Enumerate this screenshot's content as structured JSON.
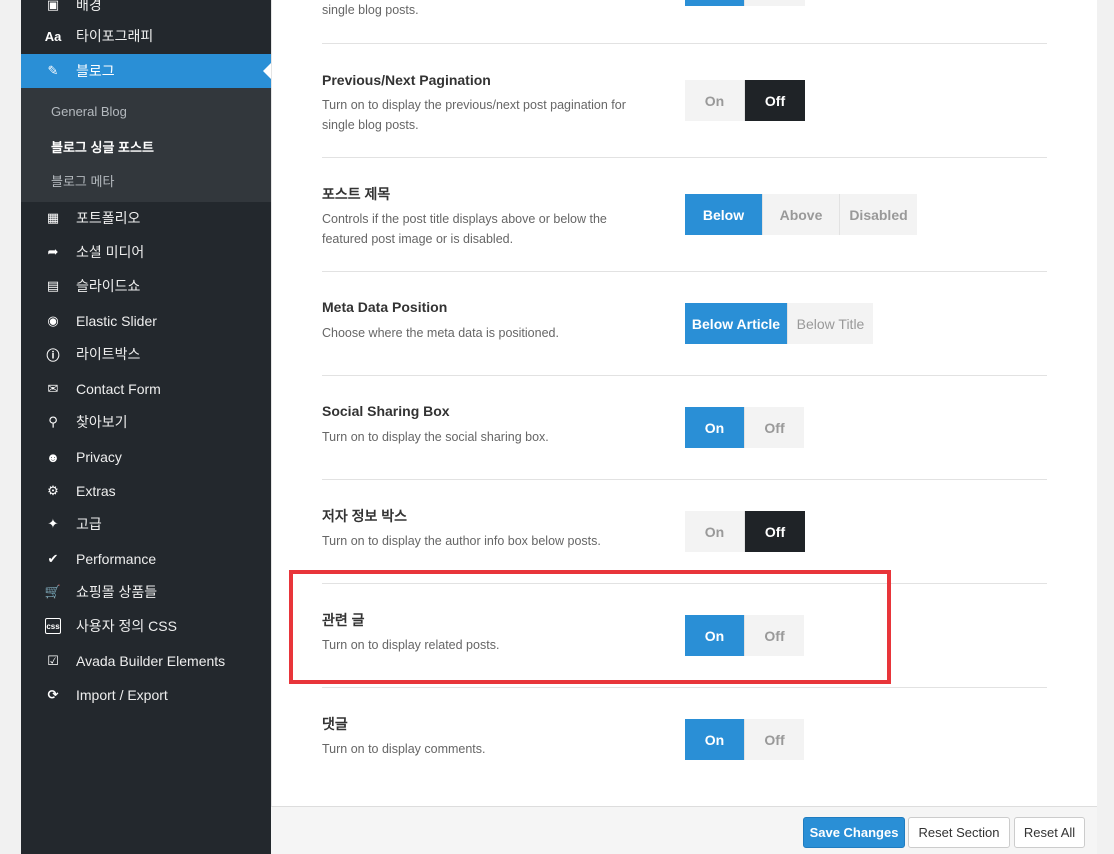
{
  "sidebar": {
    "items": [
      {
        "label": "배경",
        "icon": "layout-icon"
      },
      {
        "label": "타이포그래피",
        "icon": "typography-icon"
      },
      {
        "label": "블로그",
        "icon": "edit-icon"
      },
      {
        "label": "포트폴리오",
        "icon": "grid-icon"
      },
      {
        "label": "소셜 미디어",
        "icon": "share-icon"
      },
      {
        "label": "슬라이드쇼",
        "icon": "image-icon"
      },
      {
        "label": "Elastic Slider",
        "icon": "slider-icon"
      },
      {
        "label": "라이트박스",
        "icon": "info-icon"
      },
      {
        "label": "Contact Form",
        "icon": "envelope-icon"
      },
      {
        "label": "찾아보기",
        "icon": "search-icon"
      },
      {
        "label": "Privacy",
        "icon": "user-icon"
      },
      {
        "label": "Extras",
        "icon": "cogs-icon"
      },
      {
        "label": "고급",
        "icon": "puzzle-icon"
      },
      {
        "label": "Performance",
        "icon": "check-circle-icon"
      },
      {
        "label": "쇼핑몰 상품들",
        "icon": "cart-icon"
      },
      {
        "label": "사용자 정의 CSS",
        "icon": "css-icon"
      },
      {
        "label": "Avada Builder Elements",
        "icon": "checkbox-icon"
      },
      {
        "label": "Import / Export",
        "icon": "refresh-icon"
      }
    ],
    "submenu": [
      "General Blog",
      "블로그 싱글 포스트",
      "블로그 메타"
    ]
  },
  "settings": {
    "top_fragment": "single blog posts.",
    "rows": [
      {
        "title": "Previous/Next Pagination",
        "desc": "Turn on to display the previous/next post pagination for single blog posts.",
        "options": [
          "On",
          "Off"
        ],
        "selected": "Off"
      },
      {
        "title": "포스트 제목",
        "desc": "Controls if the post title displays above or below the featured post image or is disabled.",
        "options": [
          "Below",
          "Above",
          "Disabled"
        ],
        "selected": "Below"
      },
      {
        "title": "Meta Data Position",
        "desc": "Choose where the meta data is positioned.",
        "options": [
          "Below Article",
          "Below Title"
        ],
        "selected": "Below Article"
      },
      {
        "title": "Social Sharing Box",
        "desc": "Turn on to display the social sharing box.",
        "options": [
          "On",
          "Off"
        ],
        "selected": "On"
      },
      {
        "title": "저자 정보 박스",
        "desc": "Turn on to display the author info box below posts.",
        "options": [
          "On",
          "Off"
        ],
        "selected": "Off"
      },
      {
        "title": "관련 글",
        "desc": "Turn on to display related posts.",
        "options": [
          "On",
          "Off"
        ],
        "selected": "On"
      },
      {
        "title": "댓글",
        "desc": "Turn on to display comments.",
        "options": [
          "On",
          "Off"
        ],
        "selected": "On"
      }
    ]
  },
  "footer": {
    "save": "Save Changes",
    "reset_section": "Reset Section",
    "reset_all": "Reset All"
  },
  "colors": {
    "accent": "#2a8fd6",
    "sidebar_bg": "#23282d",
    "highlight": "#e8353a"
  }
}
